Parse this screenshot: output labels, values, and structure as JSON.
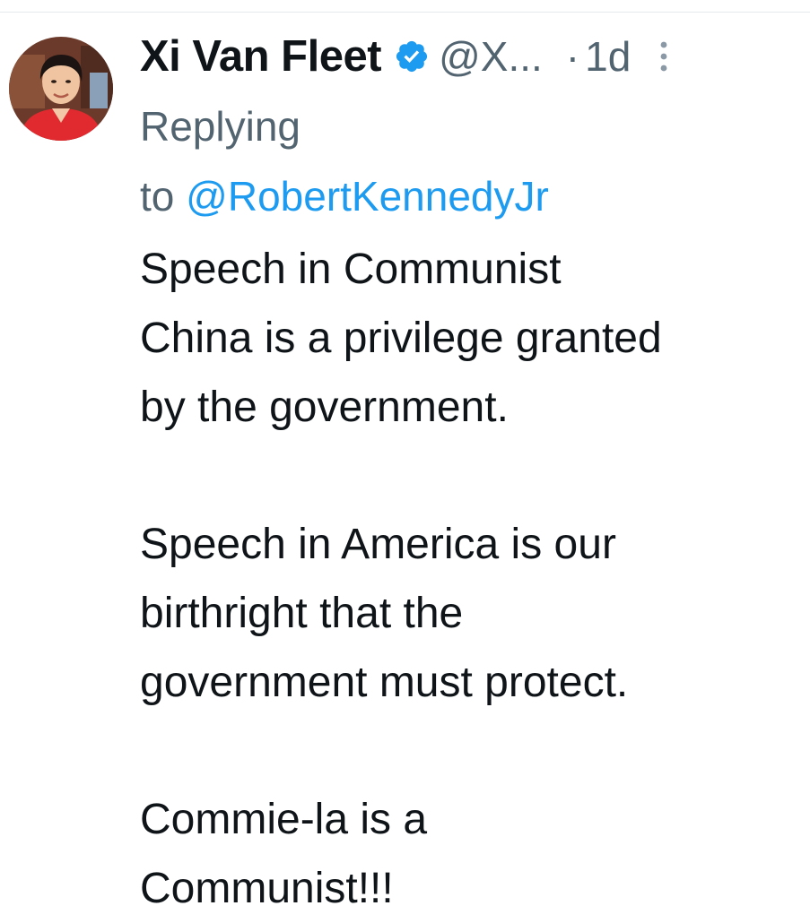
{
  "tweet": {
    "author": {
      "display_name": "Xi Van Fleet",
      "handle": "@X...",
      "verified": true,
      "avatar_icon": "profile-photo"
    },
    "separator": "·",
    "timestamp": "1d",
    "replying_prefix": "Replying",
    "replying_to_word": "to",
    "replying_to_handle": "@RobertKennedyJr",
    "body": {
      "p1": [
        "Speech in Communist",
        "China is a privilege granted",
        "by the government."
      ],
      "p2": [
        "Speech in America is our",
        "birthright that the",
        "government must protect."
      ],
      "p3": [
        "Commie-la is a",
        "Communist!!!"
      ]
    }
  },
  "colors": {
    "text_primary": "#0f1419",
    "text_secondary": "#536471",
    "accent": "#1d9bf0",
    "verified": "#1d9bf0"
  }
}
